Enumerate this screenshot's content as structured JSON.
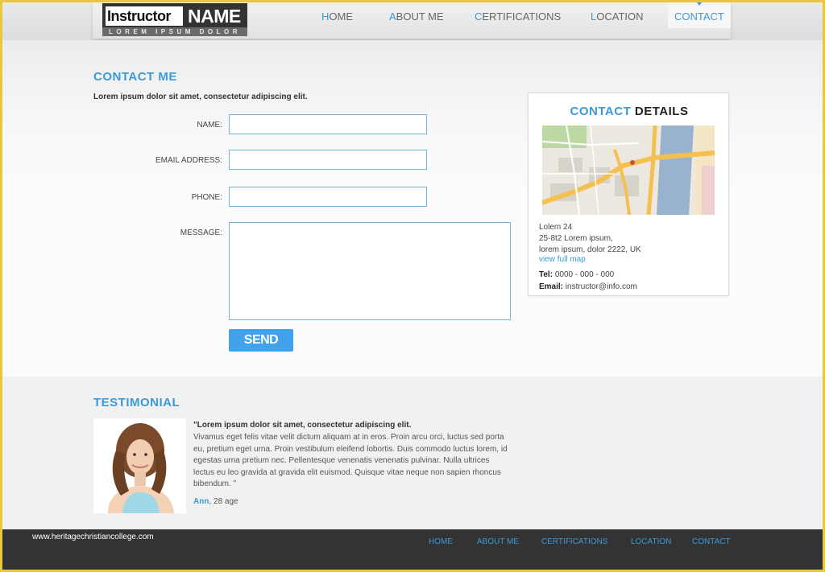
{
  "logo": {
    "word1": "Instructor",
    "word2": "NAME",
    "tagline": "LOREM IPSUM DOLOR"
  },
  "nav": {
    "items": [
      {
        "first": "H",
        "rest": "OME"
      },
      {
        "first": "A",
        "rest": "BOUT ME"
      },
      {
        "first": "C",
        "rest": "ERTIFICATIONS"
      },
      {
        "first": "L",
        "rest": "OCATION"
      },
      {
        "first": "",
        "rest": "CONTACT"
      }
    ],
    "active_index": 4
  },
  "contact": {
    "title": "CONTACT ME",
    "intro": "Lorem ipsum dolor sit amet, consectetur adipiscing elit.",
    "labels": {
      "name": "NAME:",
      "email": "EMAIL ADDRESS:",
      "phone": "PHONE:",
      "message": "MESSAGE:"
    },
    "values": {
      "name": "",
      "email": "",
      "phone": "",
      "message": ""
    },
    "send_label": "SEND"
  },
  "details": {
    "title_blue": "CONTACT",
    "title_dark": "DETAILS",
    "address_lines": [
      "Lolem 24",
      "25-8t2 Lorem ipsum,",
      "lorem ipsum, dolor 2222, UK"
    ],
    "map_link": "view full map",
    "tel_label": "Tel:",
    "tel_value": "0000 - 000 - 000",
    "email_label": "Email:",
    "email_value": "instructor@info.com"
  },
  "testimonial": {
    "title": "TESTIMONIAL",
    "lead": "\"Lorem ipsum dolor sit amet, consectetur adipiscing elit.",
    "body": "Vivamus eget felis vitae velit dictum aliquam at in eros. Proin arcu orci, luctus sed porta eu, pretium eget urna. Proin vestibulum eleifend lobortis. Duis commodo luctus lorem, id egestas urna pretium nec. Pellentesque venenatis venenatis pulvinar. Nulla ultrices lectus eu leo gravida at gravida elit euismod. Quisque vitae neque non sapien rhoncus bibendum. \"",
    "author_name": "Ann",
    "author_meta": ", 28 age"
  },
  "footer": {
    "url": "www.heritagechristiancollege.com",
    "links": [
      "HOME",
      "ABOUT ME",
      "CERTIFICATIONS",
      "LOCATION",
      "CONTACT"
    ]
  },
  "colors": {
    "accent": "#3a9ad9",
    "frame": "#e7c83a",
    "footer": "#333333",
    "button": "#3fa2ea"
  }
}
